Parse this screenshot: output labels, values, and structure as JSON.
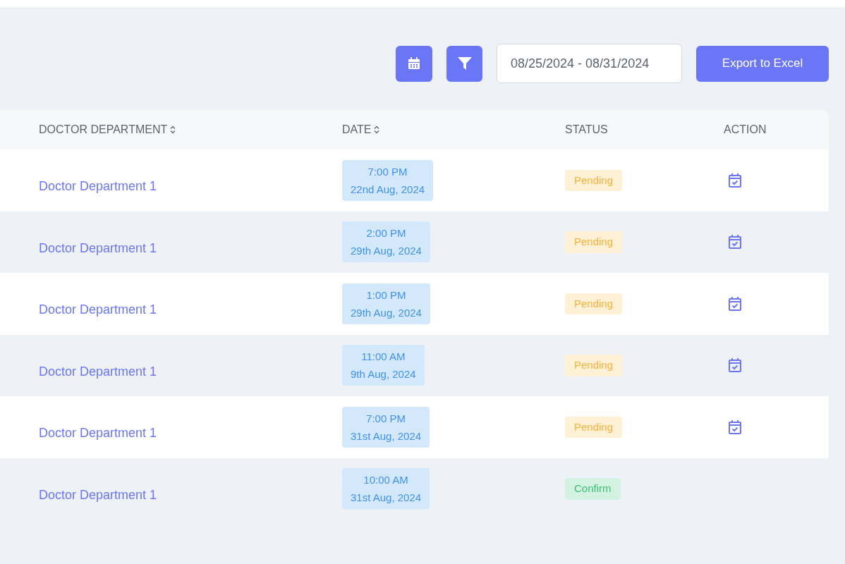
{
  "toolbar": {
    "date_range": "08/25/2024 - 08/31/2024",
    "export_button": "Export to Excel"
  },
  "table": {
    "columns": [
      {
        "label": "DOCTOR DEPARTMENT",
        "sortable": true
      },
      {
        "label": "DATE",
        "sortable": true
      },
      {
        "label": "STATUS",
        "sortable": false
      },
      {
        "label": "ACTION",
        "sortable": false
      }
    ],
    "rows": [
      {
        "department": "Doctor Department 1",
        "time": "7:00 PM",
        "date": "22nd Aug, 2024",
        "status": {
          "label": "Pending",
          "kind": "pending"
        },
        "has_action": true
      },
      {
        "department": "Doctor Department 1",
        "time": "2:00 PM",
        "date": "29th Aug, 2024",
        "status": {
          "label": "Pending",
          "kind": "pending"
        },
        "has_action": true
      },
      {
        "department": "Doctor Department 1",
        "time": "1:00 PM",
        "date": "29th Aug, 2024",
        "status": {
          "label": "Pending",
          "kind": "pending"
        },
        "has_action": true
      },
      {
        "department": "Doctor Department 1",
        "time": "11:00 AM",
        "date": "9th Aug, 2024",
        "status": {
          "label": "Pending",
          "kind": "pending"
        },
        "has_action": true
      },
      {
        "department": "Doctor Department 1",
        "time": "7:00 PM",
        "date": "31st Aug, 2024",
        "status": {
          "label": "Pending",
          "kind": "pending"
        },
        "has_action": true
      },
      {
        "department": "Doctor Department 1",
        "time": "10:00 AM",
        "date": "31st Aug, 2024",
        "status": {
          "label": "Confirm",
          "kind": "confirm"
        },
        "has_action": false
      }
    ]
  }
}
